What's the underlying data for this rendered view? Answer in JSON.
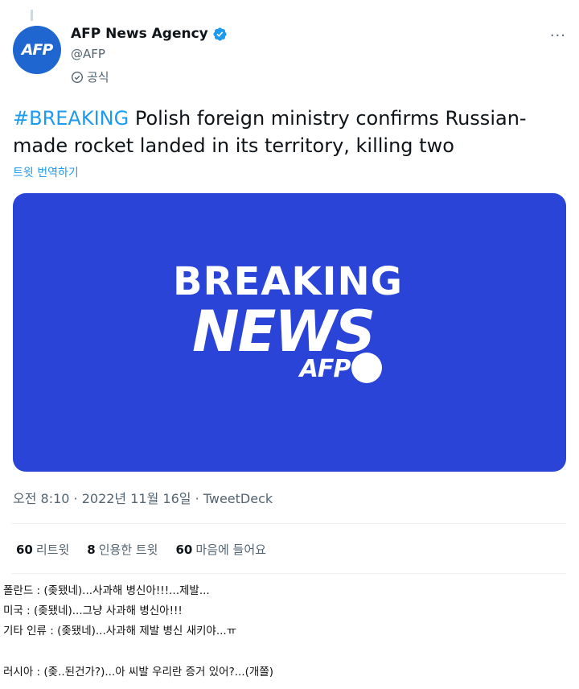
{
  "tweet": {
    "author_name": "AFP News Agency",
    "handle": "@AFP",
    "official_label": "공식",
    "avatar_text": "AFP",
    "more_label": "···",
    "hashtag": "#BREAKING",
    "text": " Polish foreign ministry confirms Russian-made rocket landed in its territory, killing two",
    "translate_label": "트윗 번역하기",
    "media": {
      "line1": "BREAKING",
      "line2": "NEWS",
      "brand": "AFP",
      "background_color": "#2b44d8"
    },
    "timestamp": "오전 8:10 · 2022년 11월 16일 · TweetDeck",
    "stats": [
      {
        "count": "60",
        "label": "리트윗"
      },
      {
        "count": "8",
        "label": "인용한 트윗"
      },
      {
        "count": "60",
        "label": "마음에 들어요"
      }
    ]
  },
  "comments": [
    "폴란드 : (좆됐네)...사과해 병신아!!!...제발...",
    "미국 : (좆됐네)...그냥 사과해 병신아!!!",
    "기타 인류 : (좆됐네)...사과해 제발 병신 새키야...ㅠ",
    "러시아 : (좆..된건가?)...아 씨발 우리란 증거 있어?...(개쫄)"
  ],
  "colors": {
    "accent": "#1d9bf0",
    "avatar": "#1f66d0",
    "secondary_text": "#536471"
  }
}
